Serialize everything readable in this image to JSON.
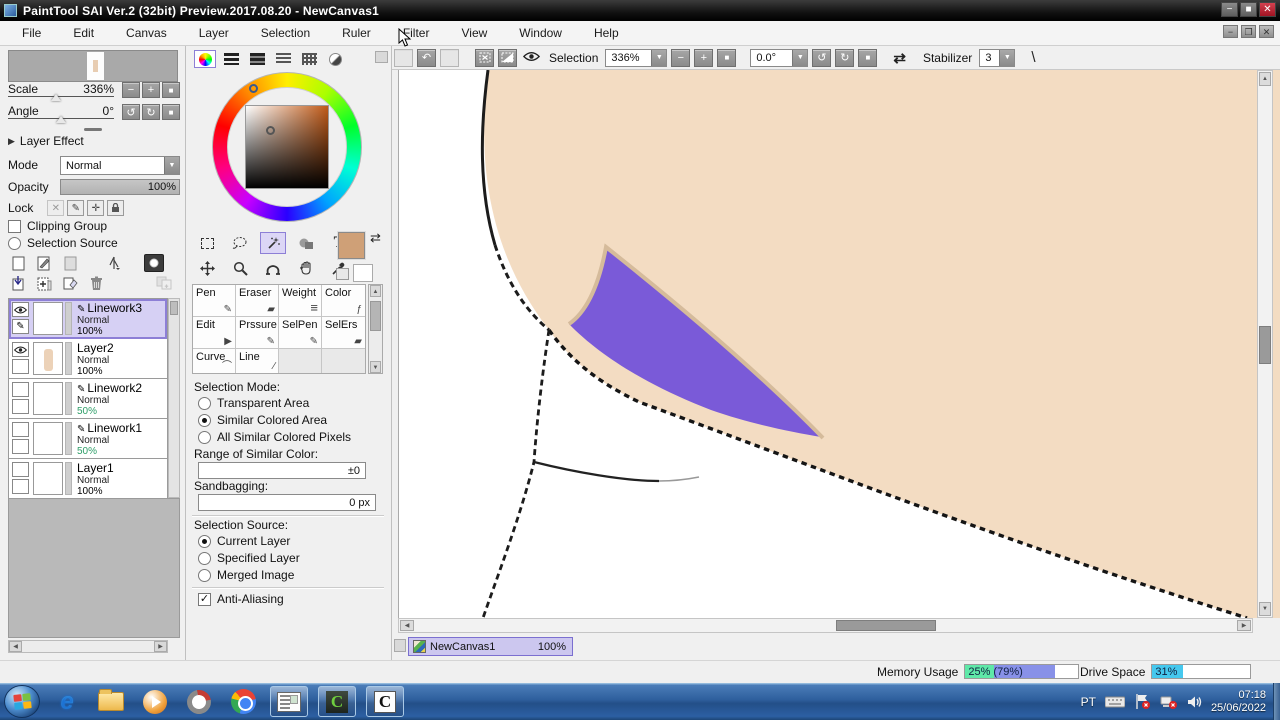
{
  "titlebar": {
    "title": "PaintTool SAI Ver.2 (32bit) Preview.2017.08.20 - NewCanvas1"
  },
  "menu": {
    "items": [
      "File",
      "Edit",
      "Canvas",
      "Layer",
      "Selection",
      "Ruler",
      "Filter",
      "View",
      "Window",
      "Help"
    ]
  },
  "toolbar": {
    "selection_label": "Selection",
    "zoom_value": "336%",
    "angle_value": "0.0°",
    "stabilizer_label": "Stabilizer",
    "stabilizer_value": "3"
  },
  "navigator": {
    "scale_label": "Scale",
    "scale_value": "336%",
    "angle_label": "Angle",
    "angle_value": "0°"
  },
  "layer_panel": {
    "layer_effect_label": "Layer Effect",
    "mode_label": "Mode",
    "mode_value": "Normal",
    "opacity_label": "Opacity",
    "opacity_value": "100%",
    "lock_label": "Lock",
    "clipping_group_label": "Clipping Group",
    "selection_source_label": "Selection Source",
    "layers": [
      {
        "name": "Linework3",
        "mode": "Normal",
        "opacity": "100%",
        "type": "linework",
        "selected": true,
        "visible": true
      },
      {
        "name": "Layer2",
        "mode": "Normal",
        "opacity": "100%",
        "type": "raster",
        "selected": false,
        "visible": true
      },
      {
        "name": "Linework2",
        "mode": "Normal",
        "opacity": "50%",
        "type": "linework",
        "selected": false,
        "visible": false
      },
      {
        "name": "Linework1",
        "mode": "Normal",
        "opacity": "50%",
        "type": "linework",
        "selected": false,
        "visible": false
      },
      {
        "name": "Layer1",
        "mode": "Normal",
        "opacity": "100%",
        "type": "raster",
        "selected": false,
        "visible": false
      }
    ]
  },
  "tool_panel": {
    "grid": [
      [
        "Pen",
        "Eraser",
        "Weight",
        "Color"
      ],
      [
        "Edit",
        "Prssure",
        "SelPen",
        "SelErs"
      ],
      [
        "Curve",
        "Line",
        "",
        ""
      ]
    ]
  },
  "selection_panel": {
    "mode_label": "Selection Mode:",
    "modes": [
      "Transparent Area",
      "Similar Colored Area",
      "All Similar Colored Pixels"
    ],
    "selected_mode": "Similar Colored Area",
    "range_label": "Range of Similar Color:",
    "range_value": "±0",
    "sandbagging_label": "Sandbagging:",
    "sandbagging_value": "0 px",
    "source_label": "Selection Source:",
    "sources": [
      "Current Layer",
      "Specified Layer",
      "Merged Image"
    ],
    "selected_source": "Current Layer",
    "antialiasing_label": "Anti-Aliasing",
    "antialiasing_checked": true
  },
  "canvas": {
    "tab_name": "NewCanvas1",
    "tab_zoom": "100%",
    "skin_color": "#f3dcc2",
    "purple_color": "#7a5ad8",
    "outline_color": "#d5bb9b"
  },
  "status_bar": {
    "memory_label": "Memory Usage",
    "memory_value": "25% (79%)",
    "memory_green": "#5fe8a8",
    "memory_blue": "#8891e8",
    "drive_label": "Drive Space",
    "drive_value": "31%",
    "drive_color": "#45c8ee"
  },
  "taskbar": {
    "language": "PT",
    "time": "07:18",
    "date": "25/06/2022"
  },
  "icons": {
    "minus": "−",
    "plus": "+",
    "square": "■",
    "undo": "↶",
    "rotate_ccw": "↺",
    "rotate_cw": "↻",
    "swap": "⇄",
    "dropdown": "▼",
    "left": "◀",
    "right": "▶",
    "up": "▲",
    "down": "▼",
    "check": "✓",
    "pencil": "✎",
    "text_tool": "T",
    "line": "\\",
    "collapse": "▶",
    "move": "✛",
    "magnifier": "Q",
    "rotate_tool": "Ω",
    "hand": "W",
    "eyedrop": "/",
    "lasso": "Q",
    "wand": "⁕",
    "trash": "▯",
    "plus_page": "+",
    "down_page": "↧",
    "clear_page": "◇",
    "pen_ic": "✎",
    "eraser_ic": "▰",
    "weight_ic": "≡",
    "color_ic": "ƒ",
    "edit_ic": "▶",
    "curve_ic": "⌒",
    "line_ic": "∕",
    "pm": "±"
  }
}
